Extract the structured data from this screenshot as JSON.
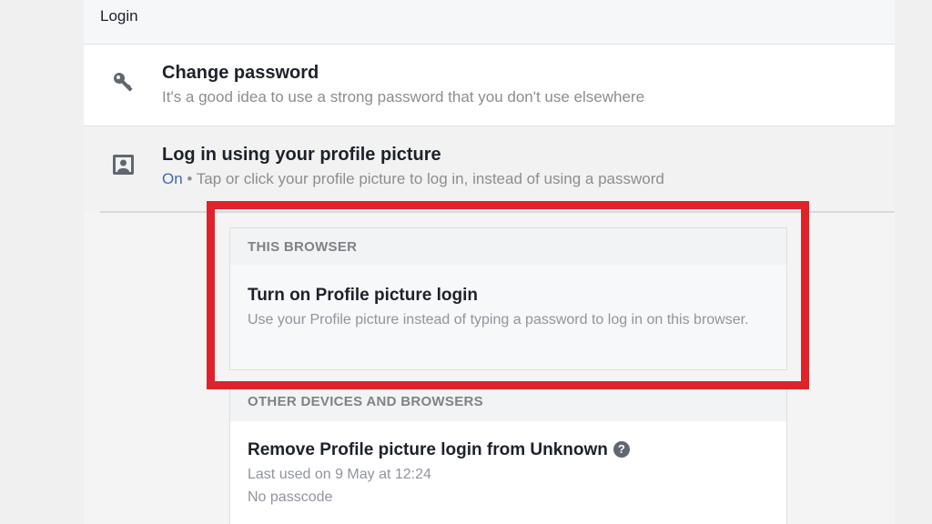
{
  "section": {
    "title": "Login"
  },
  "change_password": {
    "icon": "key-icon",
    "title": "Change password",
    "subtitle": "It's a good idea to use a strong password that you don't use elsewhere"
  },
  "profile_login": {
    "icon": "profile-picture-icon",
    "title": "Log in using your profile picture",
    "status": "On",
    "separator": " • ",
    "subtitle": "Tap or click your profile picture to log in, instead of using a password"
  },
  "this_browser": {
    "label": "THIS BROWSER",
    "title": "Turn on Profile picture login",
    "description": "Use your Profile picture instead of typing a password to log in on this browser."
  },
  "other_devices": {
    "label": "OTHER DEVICES AND BROWSERS",
    "title": "Remove Profile picture login from Unknown",
    "help_icon": "question-mark-icon",
    "help_glyph": "?",
    "last_used": "Last used on 9 May at 12:24",
    "passcode": "No passcode"
  },
  "colors": {
    "highlight": "#e0232b",
    "link_blue": "#4267b2"
  }
}
